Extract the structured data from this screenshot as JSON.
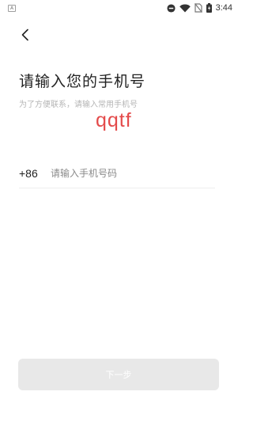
{
  "status_bar": {
    "notification_icon": "A",
    "icons": [
      "do-not-disturb-icon",
      "wifi-icon",
      "no-sim-icon",
      "battery-charging-icon"
    ],
    "time": "3:44"
  },
  "header": {
    "back_icon": "chevron-left-icon"
  },
  "main": {
    "title": "请输入您的手机号",
    "subtitle": "为了方便联系，请输入常用手机号",
    "watermark": "qqtf"
  },
  "phone": {
    "country_code": "+86",
    "value": "",
    "placeholder": "请输入手机号码"
  },
  "footer": {
    "next_label": "下一步",
    "next_enabled": false
  },
  "colors": {
    "title": "#222222",
    "subtitle": "#b5b5b5",
    "watermark": "#e44b4b",
    "button_disabled_bg": "#e8e8e8",
    "button_text": "#ffffff"
  }
}
